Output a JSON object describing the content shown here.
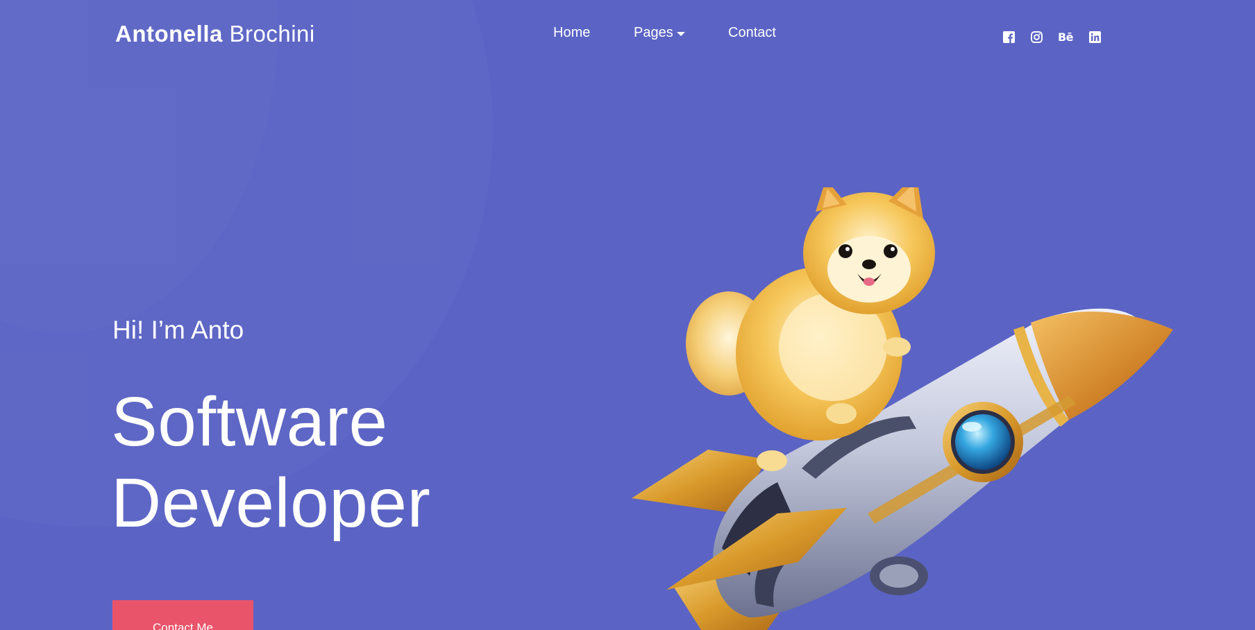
{
  "brand": {
    "first_name": "Antonella",
    "last_name": "Brochini"
  },
  "nav": {
    "home": "Home",
    "pages": "Pages",
    "contact": "Contact"
  },
  "social": [
    {
      "icon": "facebook-icon"
    },
    {
      "icon": "instagram-icon"
    },
    {
      "icon": "behance-icon",
      "glyph": "Bē"
    },
    {
      "icon": "linkedin-icon"
    }
  ],
  "hero": {
    "greeting": "Hi! I’m Anto",
    "title_line1": "Software",
    "title_line2": "Developer",
    "cta_label": "Contact Me",
    "illustration": "pomeranian-on-rocket"
  },
  "colors": {
    "background": "#5b64c4",
    "accent": "#e9546b",
    "text": "#ffffff"
  }
}
